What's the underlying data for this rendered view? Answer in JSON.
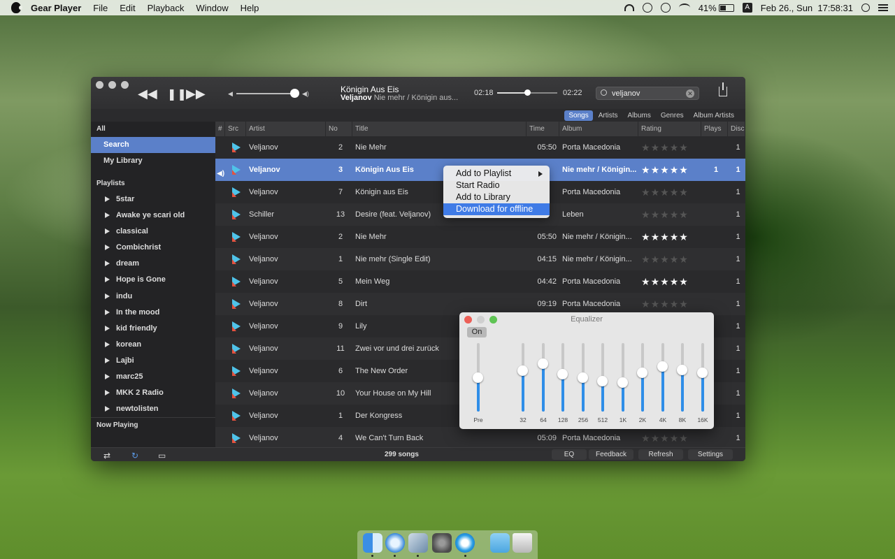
{
  "menubar": {
    "app": "Gear Player",
    "items": [
      "File",
      "Edit",
      "Playback",
      "Window",
      "Help"
    ],
    "battery": "41%",
    "input_source": "A",
    "datetime": "Feb 26., Sun  17:58:31"
  },
  "player": {
    "now_playing_title": "Königin Aus Eis",
    "now_playing_artist": "Veljanov",
    "now_playing_album": "Nie mehr / Königin aus...",
    "elapsed": "02:18",
    "total": "02:22",
    "progress": 0.5,
    "volume": 0.95,
    "search_value": "veljanov"
  },
  "tabs": [
    {
      "label": "Songs",
      "active": true
    },
    {
      "label": "Artists"
    },
    {
      "label": "Albums"
    },
    {
      "label": "Genres"
    },
    {
      "label": "Album Artists"
    }
  ],
  "sidebar": {
    "all_label": "All",
    "items": [
      {
        "label": "Search",
        "active": true
      },
      {
        "label": "My Library"
      }
    ],
    "playlists_label": "Playlists",
    "playlists": [
      "5star",
      "Awake ye scari old",
      "classical",
      "Combichrist",
      "dream",
      "Hope is Gone",
      "indu",
      "In the mood",
      "kid friendly",
      "korean",
      "Lajbi",
      "marc25",
      "MKK 2 Radio",
      "newtolisten"
    ],
    "now_playing_label": "Now Playing"
  },
  "table": {
    "columns": [
      "#",
      "Src",
      "Artist",
      "No",
      "Title",
      "Time",
      "Album",
      "Rating",
      "Plays",
      "Disc"
    ],
    "rows": [
      {
        "artist": "Veljanov",
        "no": "2",
        "title": "Nie Mehr",
        "time": "05:50",
        "album": "Porta Macedonia",
        "rating": 0,
        "plays": "",
        "disc": "1"
      },
      {
        "artist": "Veljanov",
        "no": "3",
        "title": "Königin Aus Eis",
        "time": "",
        "album": "Nie mehr / Königin...",
        "rating": 5,
        "plays": "1",
        "disc": "1",
        "selected": true
      },
      {
        "artist": "Veljanov",
        "no": "7",
        "title": "Königin aus Eis",
        "time": "",
        "album": "Porta Macedonia",
        "rating": 0,
        "plays": "",
        "disc": "1"
      },
      {
        "artist": "Schiller",
        "no": "13",
        "title": "Desire (feat. Veljanov)",
        "time": "",
        "album": "Leben",
        "rating": 0,
        "plays": "",
        "disc": "1"
      },
      {
        "artist": "Veljanov",
        "no": "2",
        "title": "Nie Mehr",
        "time": "05:50",
        "album": "Nie mehr / Königin...",
        "rating": 5,
        "plays": "",
        "disc": "1"
      },
      {
        "artist": "Veljanov",
        "no": "1",
        "title": "Nie mehr (Single Edit)",
        "time": "04:15",
        "album": "Nie mehr / Königin...",
        "rating": 0,
        "plays": "",
        "disc": "1"
      },
      {
        "artist": "Veljanov",
        "no": "5",
        "title": "Mein Weg",
        "time": "04:42",
        "album": "Porta Macedonia",
        "rating": 5,
        "plays": "",
        "disc": "1"
      },
      {
        "artist": "Veljanov",
        "no": "8",
        "title": "Dirt",
        "time": "09:19",
        "album": "Porta Macedonia",
        "rating": 0,
        "plays": "",
        "disc": "1"
      },
      {
        "artist": "Veljanov",
        "no": "9",
        "title": "Lily",
        "time": "",
        "album": "",
        "rating": 0,
        "plays": "",
        "disc": "1"
      },
      {
        "artist": "Veljanov",
        "no": "11",
        "title": "Zwei vor und drei zurück",
        "time": "",
        "album": "",
        "rating": 0,
        "plays": "",
        "disc": "1"
      },
      {
        "artist": "Veljanov",
        "no": "6",
        "title": "The New Order",
        "time": "",
        "album": "",
        "rating": 0,
        "plays": "",
        "disc": "1"
      },
      {
        "artist": "Veljanov",
        "no": "10",
        "title": "Your House on My Hill",
        "time": "",
        "album": "",
        "rating": 0,
        "plays": "",
        "disc": "1"
      },
      {
        "artist": "Veljanov",
        "no": "1",
        "title": "Der Kongress",
        "time": "",
        "album": "",
        "rating": 0,
        "plays": "",
        "disc": "1"
      },
      {
        "artist": "Veljanov",
        "no": "4",
        "title": "We Can't Turn Back",
        "time": "05:09",
        "album": "Porta Macedonia",
        "rating": 0,
        "plays": "",
        "disc": "1"
      }
    ]
  },
  "statusbar": {
    "count": "299 songs",
    "buttons": [
      "EQ",
      "Feedback",
      "Refresh",
      "Settings"
    ]
  },
  "context_menu": {
    "items": [
      {
        "label": "Add to Playlist",
        "submenu": true
      },
      {
        "label": "Start Radio"
      },
      {
        "label": "Add to Library"
      },
      {
        "label": "Download for offline",
        "highlighted": true
      }
    ]
  },
  "equalizer": {
    "title": "Equalizer",
    "on_label": "On",
    "bands": [
      {
        "label": "Pre",
        "level": 0.5
      },
      {
        "label": "32",
        "level": 0.6
      },
      {
        "label": "64",
        "level": 0.7
      },
      {
        "label": "128",
        "level": 0.55
      },
      {
        "label": "256",
        "level": 0.5
      },
      {
        "label": "512",
        "level": 0.45
      },
      {
        "label": "1K",
        "level": 0.43
      },
      {
        "label": "2K",
        "level": 0.57
      },
      {
        "label": "4K",
        "level": 0.66
      },
      {
        "label": "8K",
        "level": 0.61
      },
      {
        "label": "16K",
        "level": 0.57
      }
    ]
  },
  "icons": {
    "accent": "#5b80c9",
    "dock": [
      "finder-icon",
      "safari-icon",
      "preview-icon",
      "system-preferences-icon",
      "gear-player-icon",
      "folder-icon",
      "trash-icon"
    ]
  }
}
